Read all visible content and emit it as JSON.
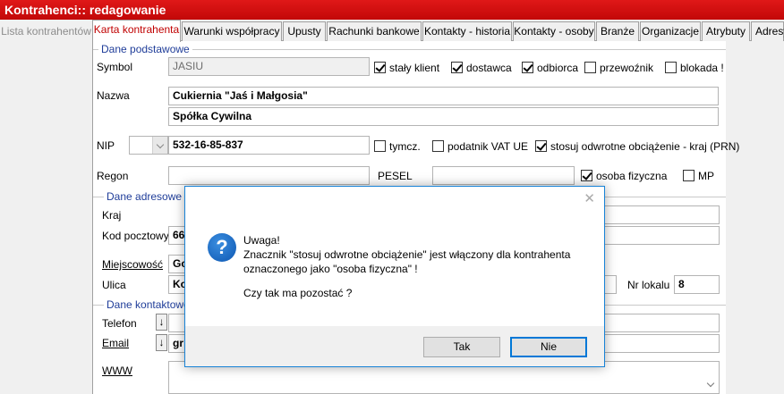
{
  "window": {
    "title": "Kontrahenci:: redagowanie"
  },
  "tabs": [
    {
      "label": "Lista kontrahentów",
      "state": "inactive"
    },
    {
      "label": "Karta kontrahenta",
      "state": "active"
    },
    {
      "label": "Warunki współpracy",
      "state": "normal"
    },
    {
      "label": "Upusty",
      "state": "normal"
    },
    {
      "label": "Rachunki bankowe",
      "state": "normal"
    },
    {
      "label": "Kontakty - historia",
      "state": "normal"
    },
    {
      "label": "Kontakty - osoby",
      "state": "normal"
    },
    {
      "label": "Branże",
      "state": "normal"
    },
    {
      "label": "Organizacje",
      "state": "normal"
    },
    {
      "label": "Atrybuty",
      "state": "normal"
    },
    {
      "label": "Adresy",
      "state": "normal"
    }
  ],
  "basic": {
    "group_title": "Dane podstawowe",
    "symbol_label": "Symbol",
    "symbol_value": "JASIU",
    "stały_klient": "stały klient",
    "dostawca": "dostawca",
    "odbiorca": "odbiorca",
    "przewoznik": "przewoźnik",
    "blokada": "blokada !",
    "nazwa_label": "Nazwa",
    "nazwa_line1": "Cukiernia \"Jaś i Małgosia\"",
    "nazwa_line2": "Spółka Cywilna",
    "nip_label": "NIP",
    "nip_value": "532-16-85-837",
    "tymcz": "tymcz.",
    "podatnik_vat_ue": "podatnik VAT UE",
    "stosuj_odwrotne": "stosuj odwrotne obciążenie - kraj (PRN)",
    "regon_label": "Regon",
    "pesel_label": "PESEL",
    "osoba_fizyczna": "osoba fizyczna",
    "mp": "MP"
  },
  "address": {
    "group_title": "Dane adresowe",
    "kraj_label": "Kraj",
    "kod_label": "Kod pocztowy",
    "kod_value_partial": "66",
    "miejscowosc_label": "Miejscowość",
    "miejscowosc_value_partial": "Go",
    "ulica_label": "Ulica",
    "ulica_value_partial": "Ko",
    "nr_lokalu_label": "Nr lokalu",
    "nr_lokalu_value": "8"
  },
  "contact": {
    "group_title": "Dane kontaktowe",
    "telefon_label": "Telefon",
    "email_label": "Email",
    "email_value_partial": "gr",
    "www_label": "WWW",
    "arrow_glyph": "↓"
  },
  "dialog": {
    "close_glyph": "✕",
    "icon_glyph": "?",
    "line1": "Uwaga!",
    "line2": "Znacznik \"stosuj odwrotne obciążenie\" jest włączony dla kontrahenta",
    "line3": "oznaczonego jako \"osoba fizyczna\" !",
    "question": "Czy tak ma pozostać ?",
    "yes_label": "Tak",
    "no_label": "Nie"
  }
}
